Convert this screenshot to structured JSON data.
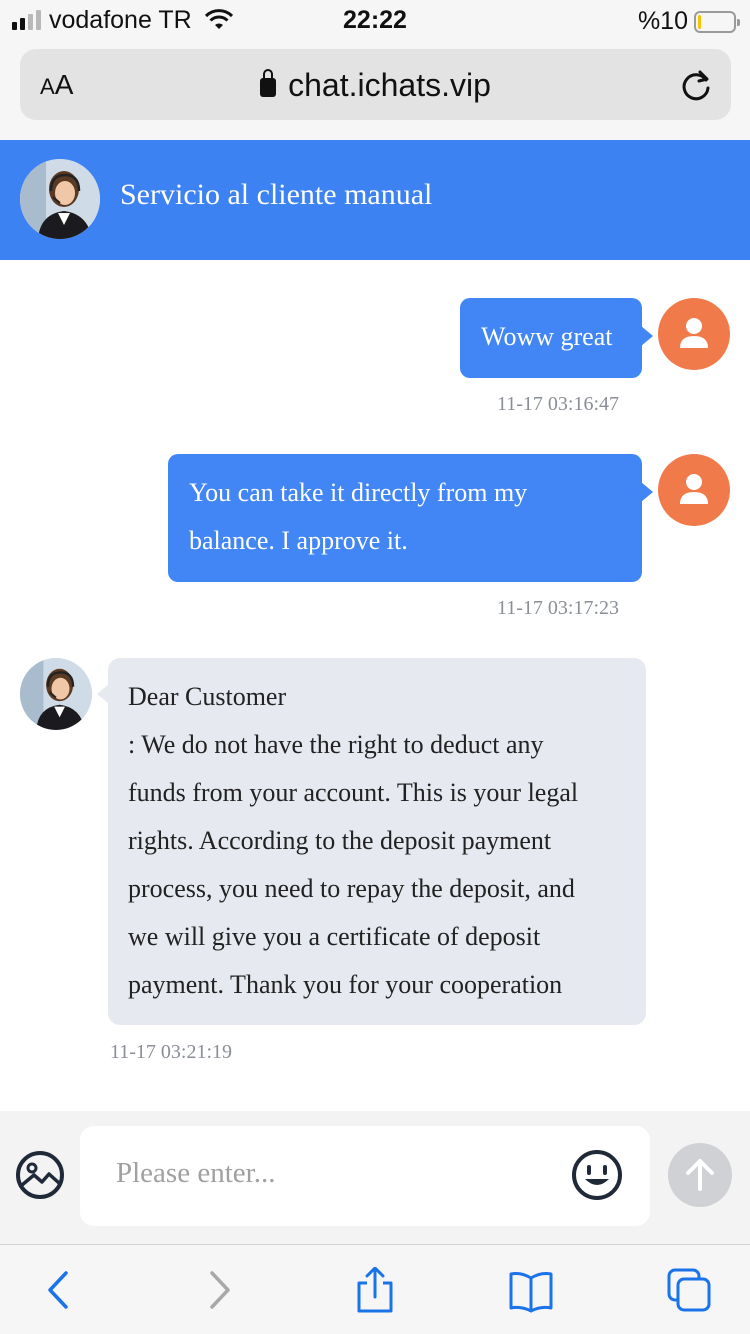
{
  "status_bar": {
    "carrier": "vodafone TR",
    "time": "22:22",
    "battery_text": "%10",
    "battery_level": 0.1
  },
  "browser": {
    "text_size_label": "AA",
    "url": "chat.ichats.vip",
    "secure": true
  },
  "chat": {
    "title": "Servicio al cliente manual",
    "messages": [
      {
        "from": "user",
        "lines": [
          "Woww great"
        ],
        "time": "11-17 03:16:47"
      },
      {
        "from": "user",
        "lines": [
          "You can take it directly from my",
          "balance. I approve it."
        ],
        "time": "11-17 03:17:23"
      },
      {
        "from": "agent",
        "lines": [
          "Dear Customer",
          ": We do not have the right to deduct any",
          "funds from your account. This is your legal",
          "rights. According to the deposit payment",
          "process, you need to repay the deposit, and",
          "we will give you a certificate of deposit",
          "payment. Thank you for your cooperation"
        ],
        "time": "11-17 03:21:19"
      }
    ]
  },
  "composer": {
    "placeholder": "Please enter...",
    "left_icon": "image-icon",
    "emoji_icon": "smiley-icon",
    "send_icon": "arrow-up-icon"
  },
  "toolbar": {
    "icons": [
      "back-icon",
      "forward-icon",
      "share-icon",
      "bookmarks-icon",
      "tabs-icon"
    ]
  },
  "colors": {
    "header_blue": "#3c82f2",
    "user_bubble": "#4186f4",
    "agent_bubble": "#e6e9ef",
    "user_avatar": "#f07a4a",
    "ios_blue": "#1a73e8"
  }
}
